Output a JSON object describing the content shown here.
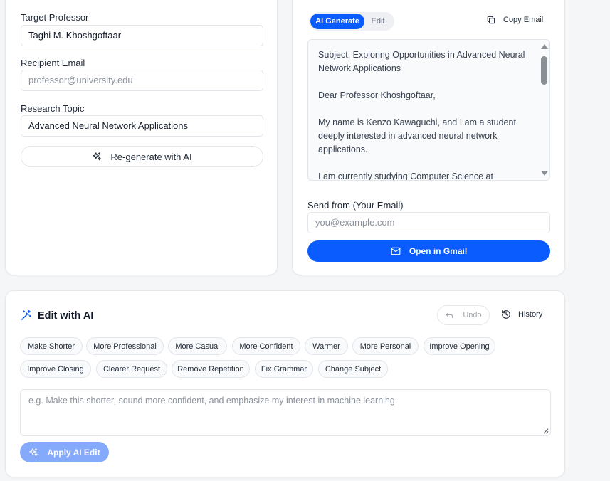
{
  "form": {
    "professor_label": "Target Professor",
    "professor_value": "Taghi M. Khoshgoftaar",
    "email_label": "Recipient Email",
    "email_placeholder": "professor@university.edu",
    "topic_label": "Research Topic",
    "topic_value": "Advanced Neural Network Applications",
    "regenerate_label": "Re-generate with AI"
  },
  "preview": {
    "tab_ai": "AI Generate",
    "tab_edit": "Edit",
    "copy_label": "Copy Email",
    "email_body": "Subject: Exploring Opportunities in Advanced Neural Network Applications\n\nDear Professor Khoshgoftaar,\n\nMy name is Kenzo Kawaguchi, and I am a student deeply interested in advanced neural network applications.\n\nI am currently studying Computer Science at",
    "send_from_label": "Send from (Your Email)",
    "send_from_placeholder": "you@example.com",
    "gmail_label": "Open in Gmail"
  },
  "ai_edit": {
    "title": "Edit with AI",
    "undo_label": "Undo",
    "history_label": "History",
    "chips": [
      "Make Shorter",
      "More Professional",
      "More Casual",
      "More Confident",
      "Warmer",
      "More Personal",
      "Improve Opening",
      "Improve Closing",
      "Clearer Request",
      "Remove Repetition",
      "Fix Grammar",
      "Change Subject"
    ],
    "instruction_placeholder": "e.g. Make this shorter, sound more confident, and emphasize my interest in machine learning.",
    "apply_label": "Apply AI Edit"
  },
  "colors": {
    "accent": "#0b5cff",
    "accent_disabled": "#86aafb"
  },
  "icons": [
    "sparkles-icon",
    "copy-icon",
    "mail-icon",
    "magic-wand-icon",
    "undo-icon",
    "history-icon",
    "resize-handle-icon"
  ]
}
